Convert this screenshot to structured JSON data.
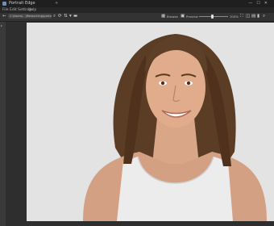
{
  "window": {
    "title": "Portrait Edge",
    "new_tab": "+",
    "controls": "—☐✕"
  },
  "menu": [
    "File",
    "Edit",
    "Settings",
    "Help"
  ],
  "toolbar": {
    "path_text": "C:\\Users\\...\\Retouching\\portrait.jpg",
    "browse_label": "Browse",
    "preview_label": "Preview",
    "zoom_value": "100%",
    "zoom_level": 0.45
  },
  "colors": {
    "canvas_bg": "#e3e3e3",
    "chrome": "#2e2e2e"
  }
}
